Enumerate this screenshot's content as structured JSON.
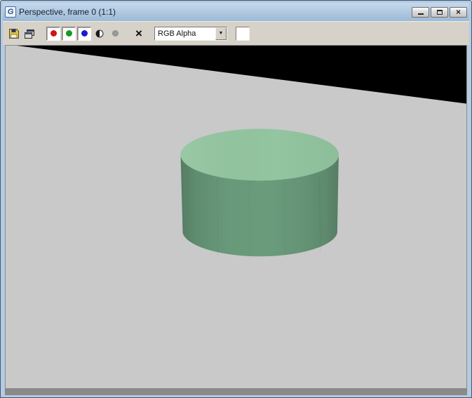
{
  "window": {
    "title": "Perspective, frame 0 (1:1)"
  },
  "titlebar": {
    "app_icon": "G",
    "close_glyph": "×"
  },
  "toolbar": {
    "buttons": {
      "save": "save-image",
      "clone": "clone-rendered-frame-window",
      "red": "enable-red-channel",
      "green": "enable-green-channel",
      "blue": "enable-blue-channel",
      "alpha": "display-alpha-channel",
      "monochrome": "monochrome",
      "clear": "clear"
    },
    "clear_glyph": "×",
    "channel_dropdown": {
      "value": "RGB Alpha",
      "arrow_glyph": "▼"
    },
    "color_swatch": "#ffffff"
  },
  "scene": {
    "ground_color": "#c9c9c9",
    "sky_color": "#000000",
    "cylinder": {
      "top_color": "#93c5a0",
      "side_color": "#6a9c7c"
    }
  },
  "colors": {
    "titlebar_gradient_top": "#c5d9ec",
    "titlebar_gradient_bottom": "#9cb9d6",
    "toolbar_background": "#d6d2c9",
    "window_frame": "#b4cbe2"
  }
}
